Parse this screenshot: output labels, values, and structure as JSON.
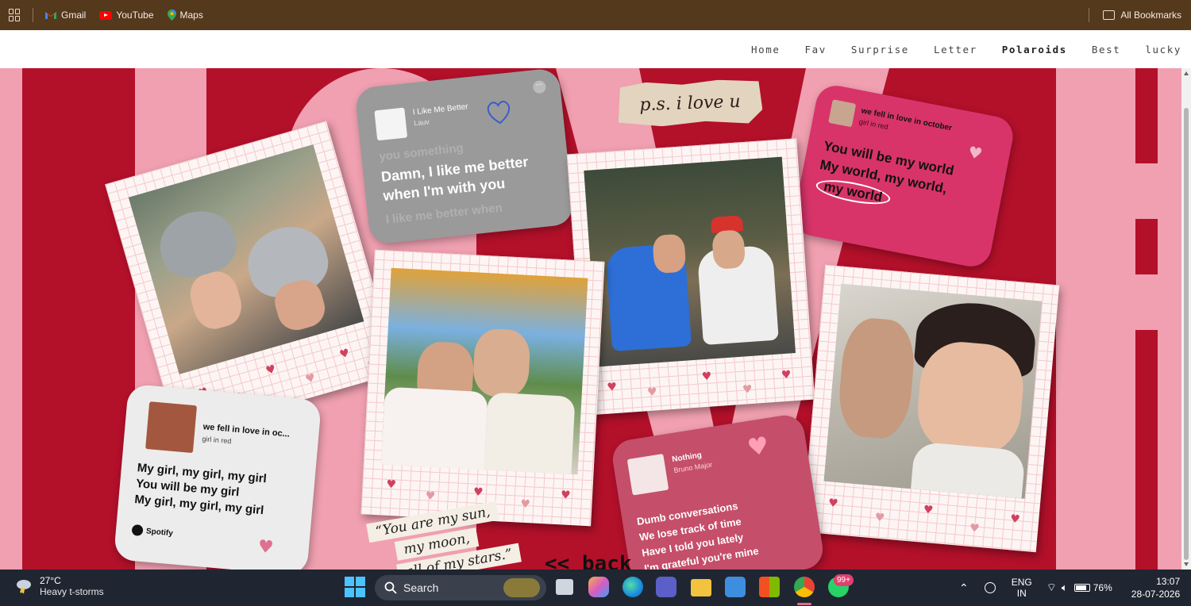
{
  "bookmarks": {
    "items": [
      {
        "label": "Gmail",
        "icon": "gmail-icon"
      },
      {
        "label": "YouTube",
        "icon": "youtube-icon"
      },
      {
        "label": "Maps",
        "icon": "maps-icon"
      }
    ],
    "all_label": "All Bookmarks"
  },
  "nav": {
    "items": [
      "Home",
      "Fav",
      "Surprise",
      "Letter",
      "Polaroids",
      "Best",
      "lucky"
    ],
    "active": "Polaroids"
  },
  "background_word": "LOVE",
  "colors": {
    "crimson": "#b3102a",
    "pink": "#f0a0b0",
    "bookmark_bar": "#55391d",
    "taskbar": "#1f2631"
  },
  "note": "p.s. i love u",
  "quote": {
    "lines": [
      "“You are my sun,",
      "my moon,",
      "all of my stars.”"
    ]
  },
  "back_link": "<< back",
  "cards": {
    "lauv": {
      "song": "I Like Me Better",
      "artist": "Lauv",
      "lyric_prev": "you something",
      "lyric_line1": "Damn, I like me better",
      "lyric_line2": "when I'm with you",
      "lyric_next": "I like me better when"
    },
    "october_top": {
      "song": "we fell in love in october",
      "artist": "girl in red",
      "lyric_line1": "You will be my world",
      "lyric_line2": "My world, my world,",
      "lyric_line3": "my world"
    },
    "october_bottom": {
      "song": "we fell in love in oc...",
      "artist": "girl in red",
      "lyric_line1": "My girl, my girl, my girl",
      "lyric_line2": "You will be my girl",
      "lyric_line3": "My girl, my girl, my girl",
      "brand": "Spotify"
    },
    "nothing": {
      "song": "Nothing",
      "artist": "Bruno Major",
      "lyric_line1": "Dumb conversations",
      "lyric_line2": "We lose track of time",
      "lyric_line3": "Have I told you lately",
      "lyric_line4": "I'm grateful you're mine"
    }
  },
  "taskbar": {
    "weather_temp": "27°C",
    "weather_desc": "Heavy t-storms",
    "search_label": "Search",
    "whatsapp_badge": "99+",
    "lang_line1": "ENG",
    "lang_line2": "IN",
    "battery": "76%",
    "time": "13:07",
    "date": "28-07-2026"
  }
}
